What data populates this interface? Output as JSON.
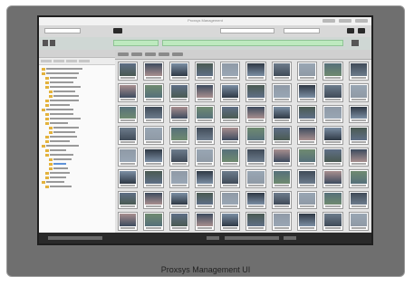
{
  "caption": "Proxsys Management UI",
  "window_title": "Proxsys Management",
  "colors": {
    "frame_bg": "#6f6f6f",
    "app_bg": "#eaeaea",
    "accent_green": "#bdeabf",
    "folder_yellow": "#e3b23c",
    "selection_blue": "#5f93d9",
    "status_dark": "#2a2a2a"
  },
  "icons": [
    "folder-icon",
    "thumbnail-image"
  ],
  "thumbnail_grid": {
    "columns": 10,
    "rows": 8,
    "palette": [
      "#5f6f86",
      "#3d4b5e",
      "#7b8ea3",
      "#4a5a52",
      "#8f9aa6",
      "#2f3945",
      "#6d7c8c",
      "#99a6b4",
      "#56707a",
      "#404b58",
      "#a88f8f",
      "#6f8a70"
    ]
  }
}
